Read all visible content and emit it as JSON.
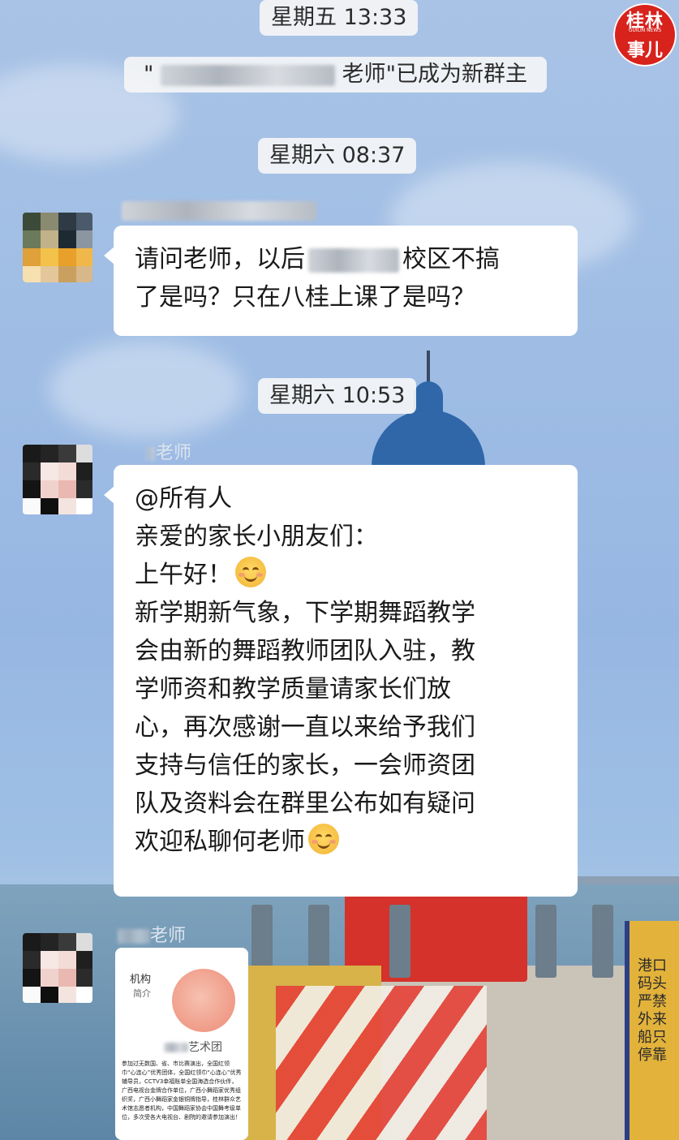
{
  "timestamps": [
    "星期五 13:33",
    "星期六 08:37",
    "星期六 10:53"
  ],
  "system_notice": {
    "prefix": "\"",
    "suffix": "老师\"已成为新群主"
  },
  "watermark": {
    "line1": "桂林",
    "line2": "GUILIN NEWS",
    "line3": "事儿"
  },
  "messages": [
    {
      "sender": "",
      "lines": [
        "请问老师，以后",
        "校区不搞",
        "了是吗？只在八桂上课了是吗？"
      ]
    },
    {
      "sender": "老师",
      "lines": [
        "@所有人",
        "亲爱的家长小朋友们：",
        "上午好！",
        "新学期新气象，下学期舞蹈教学",
        "会由新的舞蹈教师团队入驻，教",
        "学师资和教学质量请家长们放",
        "心，再次感谢一直以来给予我们",
        "支持与信任的家长，一会师资团",
        "队及资料会在群里公布如有疑问",
        "欢迎私聊何老师"
      ]
    },
    {
      "sender": "老师",
      "card": {
        "title": "机构",
        "subtitle": "简介",
        "org_suffix": "艺术团",
        "body": "参加过无数国、省、市比赛演出，全国红领巾“心连心”优秀团体，全国红领巾“心连心”优秀辅导员，CCTV3幸福账单全国海选合作伙伴，广西电视台金牌合作单位，广西小舞蹈家优秀组织奖，广西小舞蹈家金银铜牌指导，桂林群众艺术馆志愿者机构，中国舞蹈家协会中国舞考级单位，多次受各大电视台、剧院的邀请参加演出！"
      }
    }
  ],
  "sign_text": "港口码头严禁外来船只停靠",
  "colors": {
    "bubble": "#ffffff",
    "pill": "#f6f6f6",
    "logo": "#d8221c"
  }
}
